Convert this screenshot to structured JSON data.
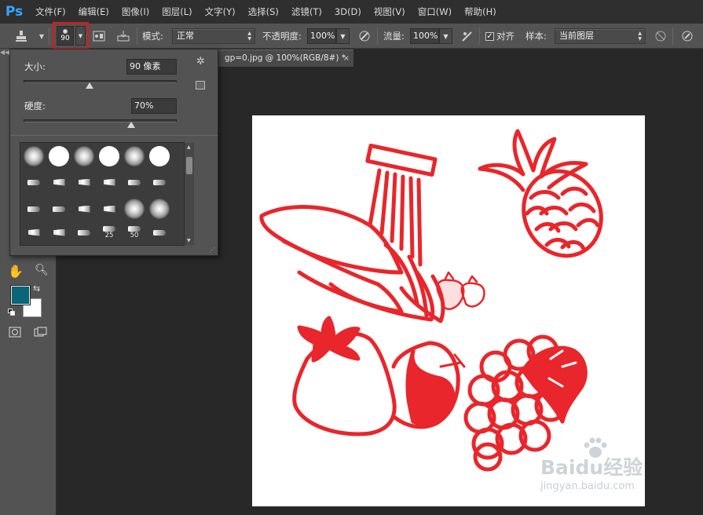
{
  "app": {
    "logo": "Ps"
  },
  "menu": [
    "文件(F)",
    "编辑(E)",
    "图像(I)",
    "图层(L)",
    "文字(Y)",
    "选择(S)",
    "滤镜(T)",
    "3D(D)",
    "视图(V)",
    "窗口(W)",
    "帮助(H)"
  ],
  "options": {
    "brush_size": "90",
    "mode_label": "模式:",
    "mode_value": "正常",
    "opacity_label": "不透明度:",
    "opacity_value": "100%",
    "flow_label": "流量:",
    "flow_value": "100%",
    "align_label": "对齐",
    "align_checked": true,
    "sample_label": "样本:",
    "sample_value": "当前图层"
  },
  "document_tab": {
    "title": "gp=0.jpg @ 100%(RGB/8#) *",
    "close": "×"
  },
  "brush_panel": {
    "size_label": "大小:",
    "size_value": "90 像素",
    "size_fraction": 0.43,
    "hardness_label": "硬度:",
    "hardness_value": "70%",
    "hardness_fraction": 0.7,
    "tips_row1": [
      "soft",
      "hard",
      "soft",
      "hard",
      "soft",
      "hard"
    ],
    "tip_labels": [
      "25",
      "50"
    ]
  },
  "colors": {
    "foreground": "#0c6479",
    "background": "#ffffff",
    "fruit_red": "#e8262b",
    "highlight_box": "#ee1111"
  },
  "watermark": {
    "brand": "Baidu经验",
    "url": "jingyan.baidu.com"
  }
}
